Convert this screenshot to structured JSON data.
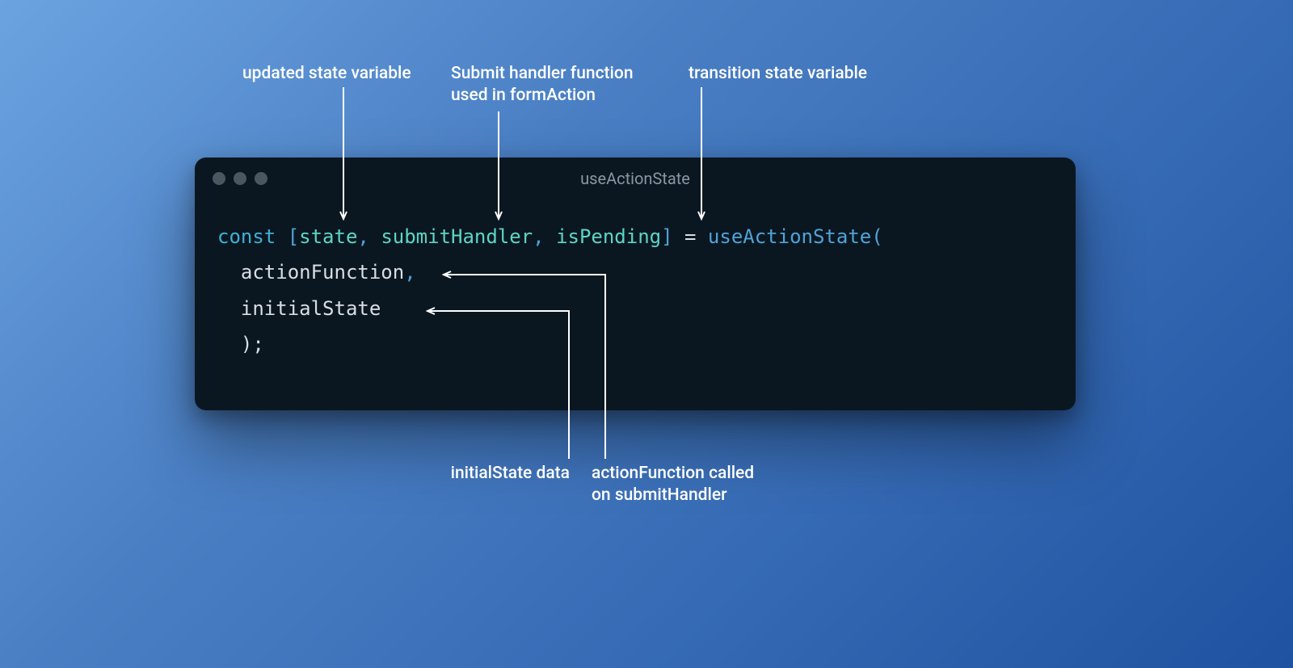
{
  "annotations": {
    "top_left": "updated state variable",
    "top_middle": "Submit handler function\nused in formAction",
    "top_right": "transition state variable",
    "bottom_left": "initialState data",
    "bottom_right": "actionFunction called\non submitHandler"
  },
  "window": {
    "title": "useActionState"
  },
  "code": {
    "kw_const": "const",
    "open_bracket": "[",
    "var_state": "state",
    "comma1": ",",
    "var_submitHandler": "submitHandler",
    "comma2": ",",
    "var_isPending": "isPending",
    "close_bracket": "]",
    "equals": "=",
    "call_useActionState": "useActionState",
    "open_paren": "(",
    "arg_actionFunction": "actionFunction",
    "comma3": ",",
    "arg_initialState": "initialState",
    "close_paren_semicolon": ");"
  }
}
